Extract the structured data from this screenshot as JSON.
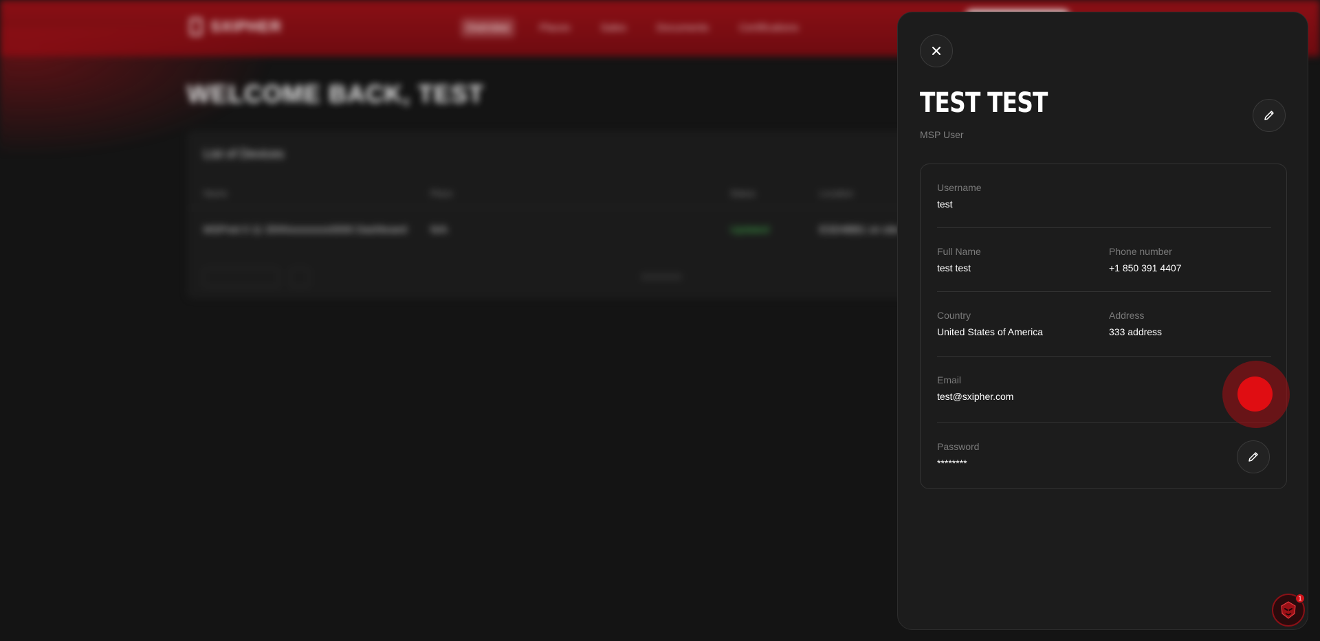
{
  "background": {
    "logo_text": "SXIPHER",
    "nav": [
      "Overview",
      "Places",
      "Sales",
      "Documents",
      "Certifications"
    ],
    "welcome": "WELCOME BACK, TEST",
    "card_title": "List of Devices",
    "columns": [
      "Name",
      "Place",
      "Status",
      "Location"
    ],
    "row": {
      "name": "MSPnet 0 11 Shhhxxxxxxxx0000 Dashboard",
      "place": "N/A",
      "status": "Updated",
      "location": "ESD4BB1 on site"
    },
    "footer_pill": "10 items per page"
  },
  "drawer": {
    "title": "TEST TEST",
    "role": "MSP User",
    "fields": {
      "username": {
        "label": "Username",
        "value": "test"
      },
      "full_name": {
        "label": "Full Name",
        "value": "test test"
      },
      "phone": {
        "label": "Phone number",
        "value": "+1 850 391 4407"
      },
      "country": {
        "label": "Country",
        "value": "United States of America"
      },
      "address": {
        "label": "Address",
        "value": "333 address"
      },
      "email": {
        "label": "Email",
        "value": "test@sxipher.com"
      },
      "password": {
        "label": "Password",
        "value": "********"
      }
    }
  },
  "icons": {
    "close": "close-icon",
    "edit": "pencil-icon",
    "assistant": "assistant-avatar-icon"
  },
  "assistant_badge": "1",
  "colors": {
    "brand_red": "#8a0f15",
    "record_red": "#e00d12",
    "panel_bg": "#1c1c1c",
    "status_green": "#3fae4a"
  }
}
